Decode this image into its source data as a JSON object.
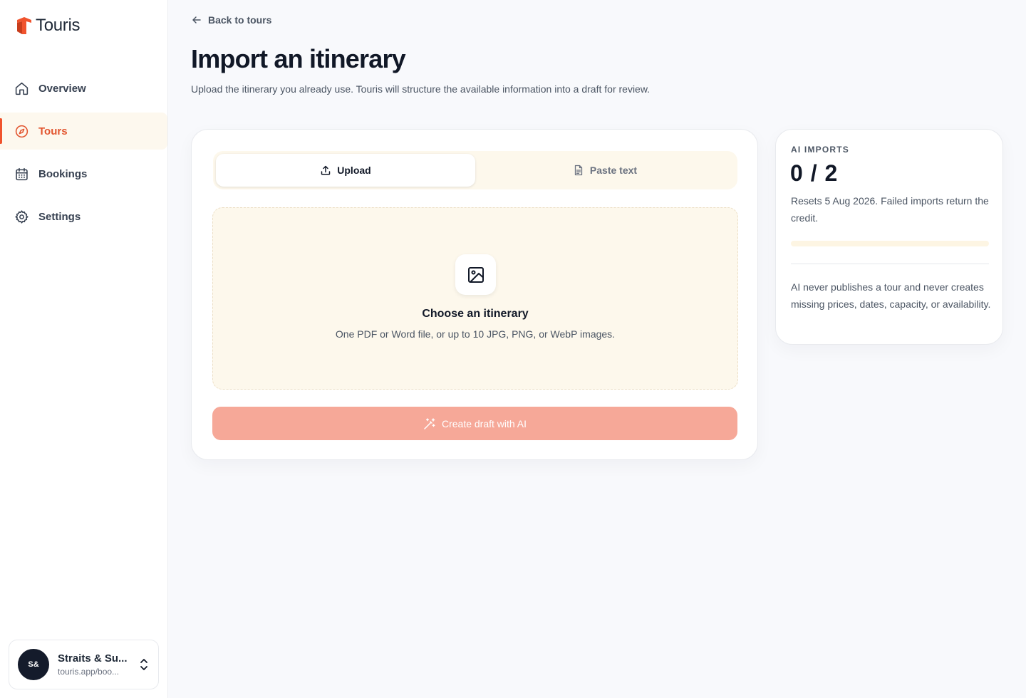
{
  "brand": {
    "name": "Touris",
    "accent": "#f0532d"
  },
  "sidebar": {
    "items": [
      {
        "label": "Overview",
        "icon": "home-icon",
        "active": false
      },
      {
        "label": "Tours",
        "icon": "compass-icon",
        "active": true
      },
      {
        "label": "Bookings",
        "icon": "calendar-icon",
        "active": false
      },
      {
        "label": "Settings",
        "icon": "gear-icon",
        "active": false
      }
    ],
    "account": {
      "initials": "S&",
      "name": "Straits & Su...",
      "url": "touris.app/boo..."
    }
  },
  "header": {
    "back_label": "Back to tours",
    "title": "Import an itinerary",
    "subtitle": "Upload the itinerary you already use. Touris will structure the available information into a draft for review."
  },
  "importer": {
    "tabs": [
      {
        "label": "Upload",
        "icon": "upload-icon",
        "active": true
      },
      {
        "label": "Paste text",
        "icon": "document-icon",
        "active": false
      }
    ],
    "dropzone": {
      "icon": "image-icon",
      "title": "Choose an itinerary",
      "hint": "One PDF or Word file, or up to 10 JPG, PNG, or WebP images."
    },
    "cta_label": "Create draft with AI",
    "cta_icon": "magic-wand-icon"
  },
  "ai_imports": {
    "label": "AI IMPORTS",
    "count": "0 / 2",
    "used": 0,
    "limit": 2,
    "reset_text": "Resets 5 Aug 2026. Failed imports return the credit.",
    "note": "AI never publishes a tour and never creates missing prices, dates, capacity, or availability."
  }
}
